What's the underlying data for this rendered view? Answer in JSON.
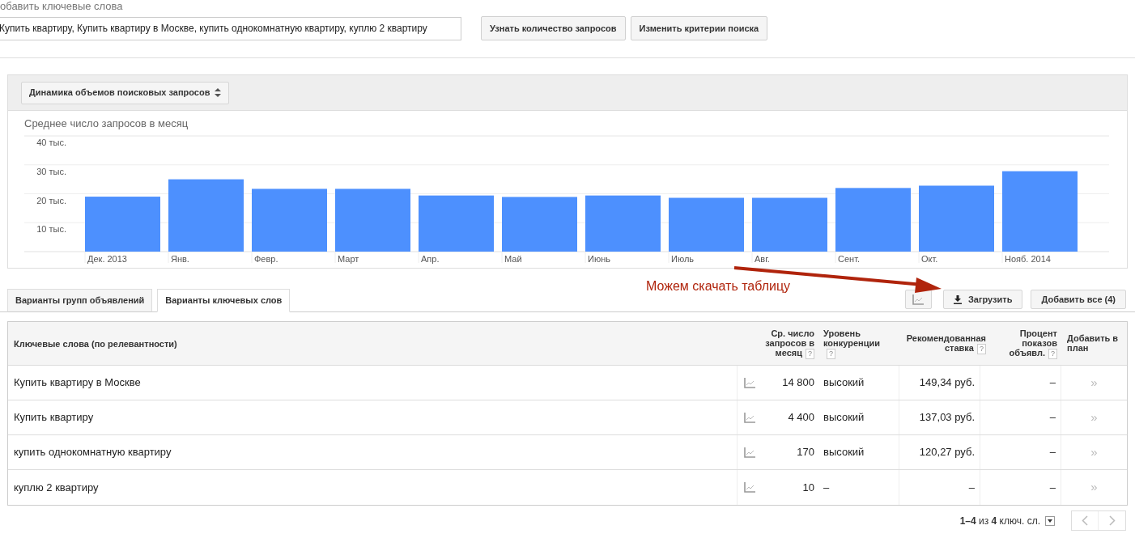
{
  "search": {
    "label": "обавить ключевые слова",
    "value": "Купить квартиру, Купить квартиру в Москве, купить однокомнатную квартиру, куплю 2 квартиру",
    "buttons": [
      "Узнать количество запросов",
      "Изменить критерии поиска"
    ]
  },
  "chart_panel": {
    "selector": "Динамика объемов поисковых запросов",
    "chart_data": {
      "type": "bar",
      "title": "Среднее число запросов в месяц",
      "categories": [
        "Дек. 2013",
        "Янв.",
        "Февр.",
        "Март",
        "Апр.",
        "Май",
        "Июнь",
        "Июль",
        "Авг.",
        "Сент.",
        "Окт.",
        "Нояб. 2014"
      ],
      "series": [
        {
          "color": "#4d90fe",
          "values": [
            19,
            25,
            21.7,
            21.7,
            19.4,
            18.9,
            19.4,
            18.6,
            18.6,
            22,
            22.8,
            27.8
          ]
        }
      ],
      "grid": true,
      "ylim": [
        0,
        40
      ],
      "yticks": [
        {
          "value": 10,
          "label": "10 тыс."
        },
        {
          "value": 20,
          "label": "20 тыс."
        },
        {
          "value": 30,
          "label": "30 тыс."
        },
        {
          "value": 40,
          "label": "40 тыс."
        }
      ]
    }
  },
  "annotation": "Можем скачать таблицу",
  "tabs": [
    {
      "label": "Варианты групп объявлений",
      "selected": false
    },
    {
      "label": "Варианты ключевых слов",
      "selected": true
    }
  ],
  "actions": [
    "Загрузить",
    "Добавить все (4)"
  ],
  "table": {
    "columns": [
      {
        "label": "Ключевые слова (по релевантности)"
      },
      {
        "label": "Ср. число запросов в месяц",
        "help": "?"
      },
      {
        "label": "Уровень конкуренции",
        "help": "?"
      },
      {
        "label": "Рекомендованная ставка",
        "help": "?"
      },
      {
        "label": "Процент показов объявл.",
        "help": "?"
      },
      {
        "label": "Добавить в план"
      }
    ],
    "rows": [
      {
        "keyword": "Купить квартиру в Москве",
        "searches": "14 800",
        "competition": "высокий",
        "bid": "149,34 руб.",
        "share": "–",
        "add": "»"
      },
      {
        "keyword": "Купить квартиру",
        "searches": "4 400",
        "competition": "высокий",
        "bid": "137,03 руб.",
        "share": "–",
        "add": "»"
      },
      {
        "keyword": "купить однокомнатную квартиру",
        "searches": "170",
        "competition": "высокий",
        "bid": "120,27 руб.",
        "share": "–",
        "add": "»"
      },
      {
        "keyword": "куплю 2 квартиру",
        "searches": "10",
        "competition": "–",
        "bid": "–",
        "share": "–",
        "add": "»"
      }
    ]
  },
  "pagination": "**1–4** из **4** ключ. сл."
}
